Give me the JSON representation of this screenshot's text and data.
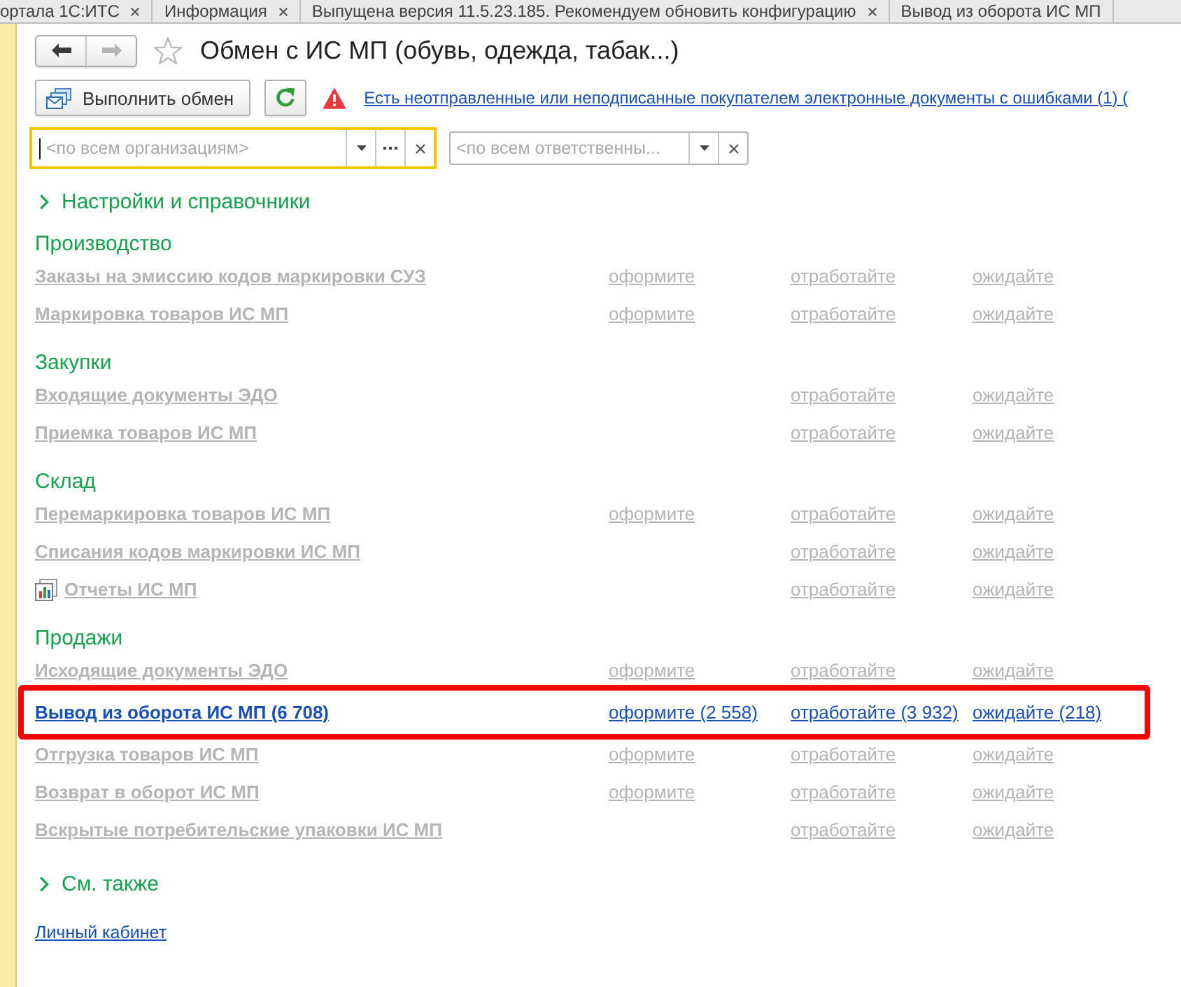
{
  "tabs": [
    {
      "label": "ортала 1С:ИТС",
      "selected": false,
      "closable": true
    },
    {
      "label": "Информация",
      "selected": false,
      "closable": true
    },
    {
      "label": "Выпущена версия 11.5.23.185. Рекомендуем обновить конфигурацию",
      "selected": false,
      "closable": true
    },
    {
      "label": "Вывод из оборота ИС МП",
      "selected": false,
      "closable": false
    }
  ],
  "navigation": {
    "back_disabled": false,
    "forward_disabled": true
  },
  "page": {
    "title": "Обмен с ИС МП (обувь, одежда, табак...)",
    "favorite": false
  },
  "toolbar": {
    "exchange_button": "Выполнить обмен",
    "warning_link": "Есть неотправленные или неподписанные покупателем электронные документы с ошибками (1) ("
  },
  "filters": [
    {
      "kind": "organization",
      "placeholder": "<по всем организациям>",
      "focused": true
    },
    {
      "kind": "person",
      "placeholder": "<по всем ответственны...",
      "focused": false
    }
  ],
  "settings_group": {
    "label": "Настройки и справочники",
    "expanded": false
  },
  "sections": [
    {
      "title": "Производство",
      "rows": [
        {
          "name": "Заказы на эмиссию кодов маркировки СУЗ",
          "kind": "document",
          "disabled": true,
          "highlighted": false,
          "issue": "оформите",
          "process": "отработайте",
          "wait": "ожидайте"
        },
        {
          "name": "Маркировка товаров ИС МП",
          "kind": "document",
          "disabled": true,
          "highlighted": false,
          "issue": "оформите",
          "process": "отработайте",
          "wait": "ожидайте"
        }
      ]
    },
    {
      "title": "Закупки",
      "rows": [
        {
          "name": "Входящие документы ЭДО",
          "kind": "document",
          "disabled": true,
          "highlighted": false,
          "process": "отработайте",
          "wait": "ожидайте"
        },
        {
          "name": "Приемка товаров ИС МП",
          "kind": "document",
          "disabled": true,
          "highlighted": false,
          "process": "отработайте",
          "wait": "ожидайте"
        }
      ]
    },
    {
      "title": "Склад",
      "rows": [
        {
          "name": "Перемаркировка товаров ИС МП",
          "kind": "document",
          "disabled": true,
          "highlighted": false,
          "issue": "оформите",
          "process": "отработайте",
          "wait": "ожидайте"
        },
        {
          "name": "Списания кодов маркировки ИС МП",
          "kind": "document",
          "disabled": true,
          "highlighted": false,
          "process": "отработайте",
          "wait": "ожидайте"
        },
        {
          "name": "Отчеты ИС МП",
          "kind": "report",
          "disabled": true,
          "highlighted": false,
          "process": "отработайте",
          "wait": "ожидайте"
        }
      ]
    },
    {
      "title": "Продажи",
      "rows": [
        {
          "name": "Исходящие документы ЭДО",
          "kind": "document",
          "disabled": true,
          "highlighted": false,
          "issue": "оформите",
          "process": "отработайте",
          "wait": "ожидайте"
        },
        {
          "name": "Вывод из оборота ИС МП (6 708)",
          "kind": "document",
          "disabled": false,
          "highlighted": true,
          "issue": "оформите (2 558)",
          "process": "отработайте (3 932)",
          "wait": "ожидайте (218)"
        },
        {
          "name": "Отгрузка товаров ИС МП",
          "kind": "document",
          "disabled": true,
          "highlighted": false,
          "issue": "оформите",
          "process": "отработайте",
          "wait": "ожидайте"
        },
        {
          "name": "Возврат в оборот ИС МП",
          "kind": "document",
          "disabled": true,
          "highlighted": false,
          "issue": "оформите",
          "process": "отработайте",
          "wait": "ожидайте"
        },
        {
          "name": "Вскрытые потребительские упаковки ИС МП",
          "kind": "document",
          "disabled": true,
          "highlighted": false,
          "process": "отработайте",
          "wait": "ожидайте"
        }
      ]
    }
  ],
  "see_also": {
    "label": "См. также",
    "expanded": false
  },
  "footer_link": "Личный кабинет"
}
